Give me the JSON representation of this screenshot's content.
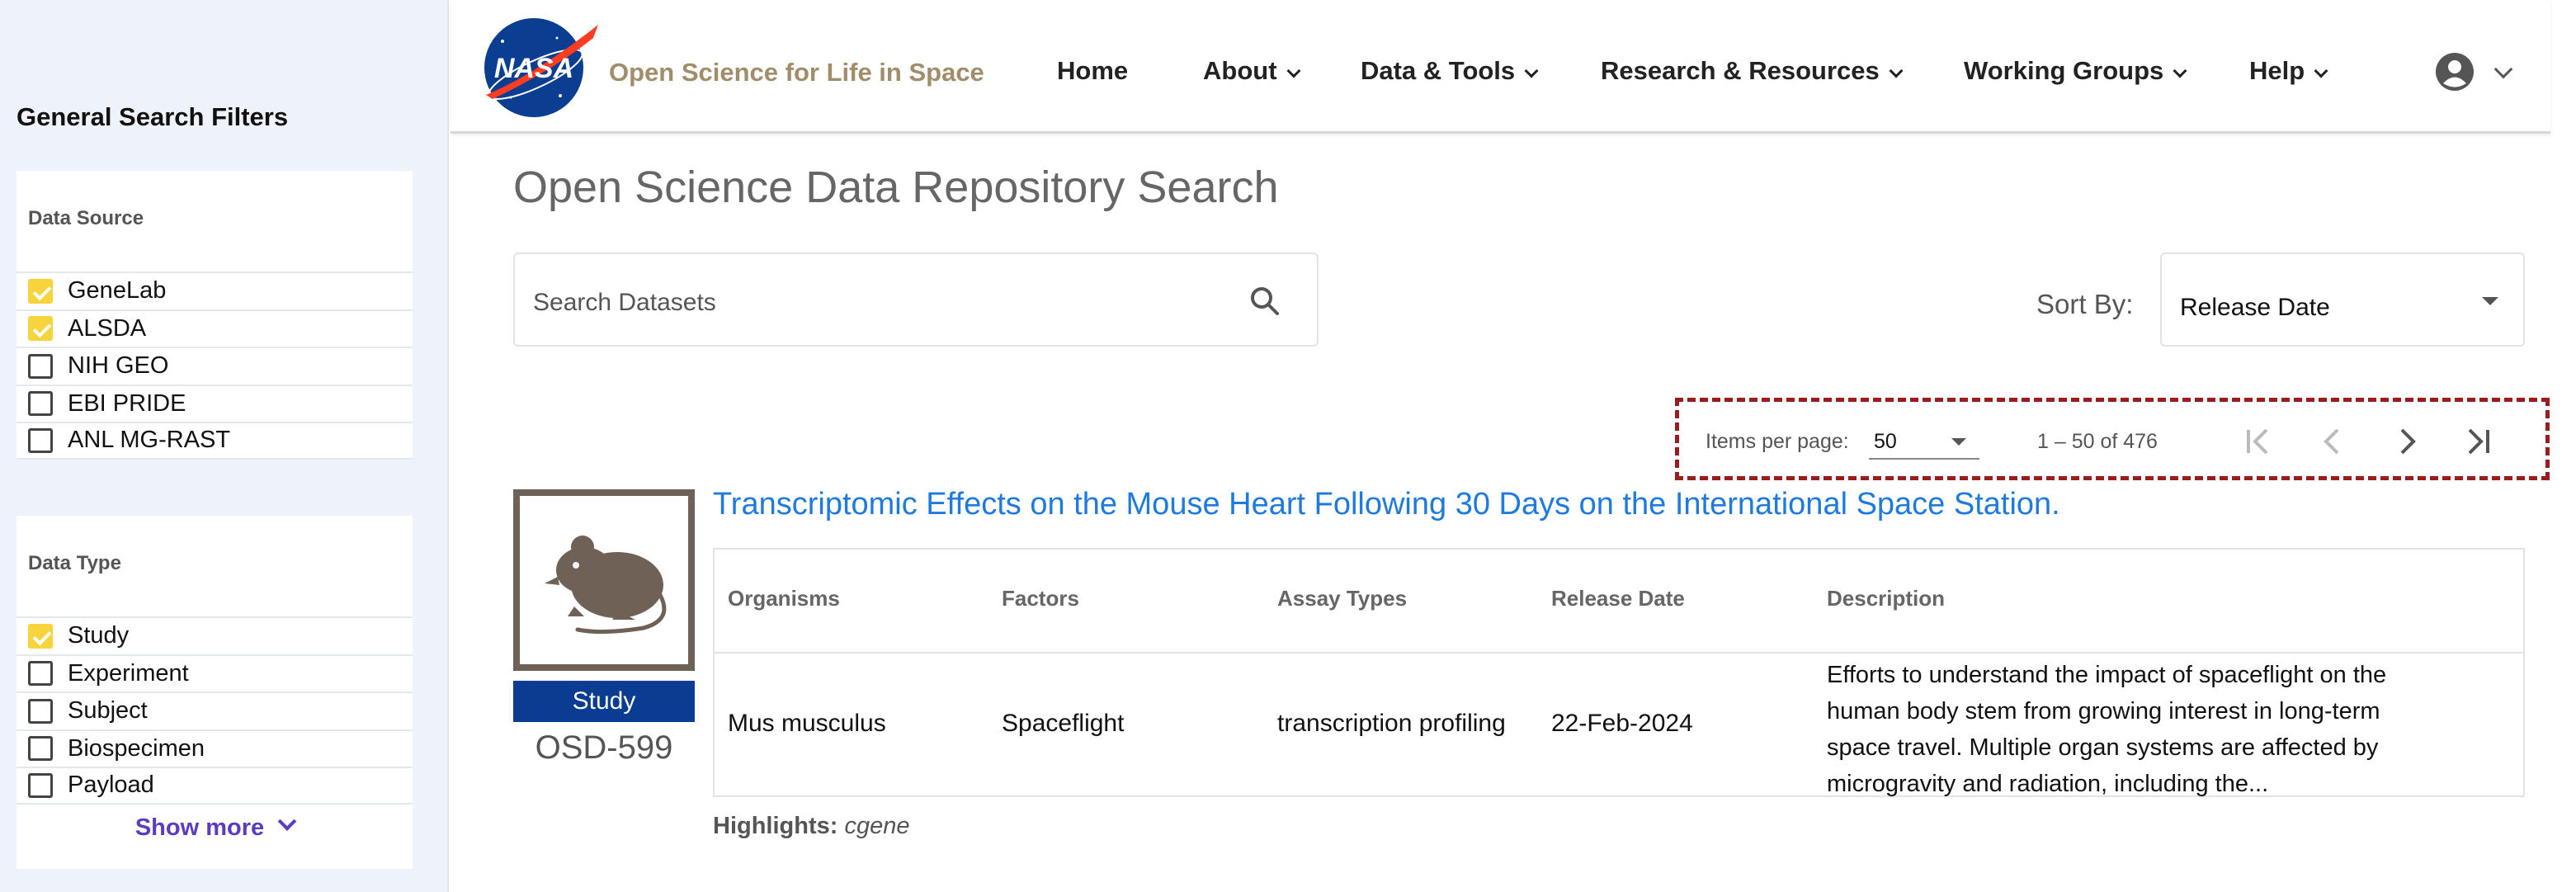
{
  "sidebar": {
    "title": "General Search Filters",
    "data_source": {
      "heading": "Data Source",
      "items": [
        {
          "label": "GeneLab",
          "checked": true
        },
        {
          "label": "ALSDA",
          "checked": true
        },
        {
          "label": "NIH GEO",
          "checked": false
        },
        {
          "label": "EBI PRIDE",
          "checked": false
        },
        {
          "label": "ANL MG-RAST",
          "checked": false
        }
      ]
    },
    "data_type": {
      "heading": "Data Type",
      "items": [
        {
          "label": "Study",
          "checked": true
        },
        {
          "label": "Experiment",
          "checked": false
        },
        {
          "label": "Subject",
          "checked": false
        },
        {
          "label": "Biospecimen",
          "checked": false
        },
        {
          "label": "Payload",
          "checked": false
        }
      ],
      "show_more": "Show more"
    }
  },
  "header": {
    "logo_text": "NASA",
    "site_name": "Open Science for Life in Space",
    "nav": [
      "Home",
      "About",
      "Data & Tools",
      "Research & Resources",
      "Working Groups",
      "Help"
    ],
    "nav_has_dropdown": [
      false,
      true,
      true,
      true,
      true,
      true
    ]
  },
  "main": {
    "title": "Open Science Data Repository Search",
    "search": {
      "placeholder": "Search Datasets"
    },
    "sort": {
      "label": "Sort By:",
      "value": "Release Date"
    },
    "paginator": {
      "items_per_page_label": "Items per page:",
      "items_per_page": "50",
      "range": "1 – 50 of 476"
    },
    "result": {
      "type_badge": "Study",
      "id": "OSD-599",
      "title": "Transcriptomic Effects on the Mouse Heart Following 30 Days on the International Space Station.",
      "columns": [
        "Organisms",
        "Factors",
        "Assay Types",
        "Release Date",
        "Description"
      ],
      "organisms": "Mus musculus",
      "factors": "Spaceflight",
      "assay_types": "transcription profiling",
      "release_date": "22-Feb-2024",
      "description": [
        "Efforts to understand the impact of spaceflight on the",
        "human body stem from growing interest in long-term",
        "space travel. Multiple organ systems are affected by",
        "microgravity and radiation, including the..."
      ],
      "highlights_label": "Highlights:",
      "highlights_value": "cgene"
    }
  },
  "colors": {
    "accent_yellow": "#f8d43c",
    "link_blue": "#1f7ae0",
    "badge_navy": "#0a3d91",
    "sidebar_bg": "#eef3fb",
    "annotation_red": "#9b1c1c",
    "brand_tan": "#a28d6b"
  }
}
